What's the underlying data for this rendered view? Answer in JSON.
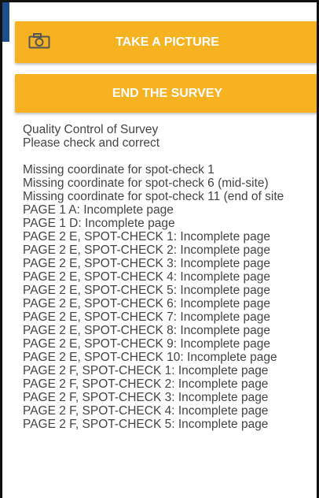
{
  "buttons": {
    "take_picture": "TAKE A PICTURE",
    "end_survey": "END THE SURVEY",
    "camera_icon": "camera-icon"
  },
  "colors": {
    "button_bg": "#f7b221",
    "button_text": "#ffffff",
    "body_text": "#444444",
    "left_strip": "#1f4f8a"
  },
  "quality_control": {
    "title": "Quality Control of Survey",
    "subtitle": "Please check and correct",
    "messages": [
      "Missing coordinate for spot-check 1",
      "Missing coordinate for spot-check 6 (mid-site)",
      "Missing coordinate for spot-check 11 (end of site",
      "PAGE 1 A: Incomplete page",
      "PAGE 1 D: Incomplete page",
      "PAGE 2 E, SPOT-CHECK 1: Incomplete page",
      "PAGE 2 E, SPOT-CHECK 2: Incomplete page",
      "PAGE 2 E, SPOT-CHECK 3: Incomplete page",
      "PAGE 2 E, SPOT-CHECK 4: Incomplete page",
      "PAGE 2 E, SPOT-CHECK 5: Incomplete page",
      "PAGE 2 E, SPOT-CHECK 6: Incomplete page",
      "PAGE 2 E, SPOT-CHECK 7: Incomplete page",
      "PAGE 2 E, SPOT-CHECK 8: Incomplete page",
      "PAGE 2 E, SPOT-CHECK 9: Incomplete page",
      "PAGE 2 E, SPOT-CHECK 10: Incomplete page",
      "PAGE 2 F, SPOT-CHECK 1: Incomplete page",
      "PAGE 2 F, SPOT-CHECK 2: Incomplete page",
      "PAGE 2 F, SPOT-CHECK 3: Incomplete page",
      "PAGE 2 F, SPOT-CHECK 4: Incomplete page",
      "PAGE 2 F, SPOT-CHECK 5: Incomplete page"
    ]
  }
}
